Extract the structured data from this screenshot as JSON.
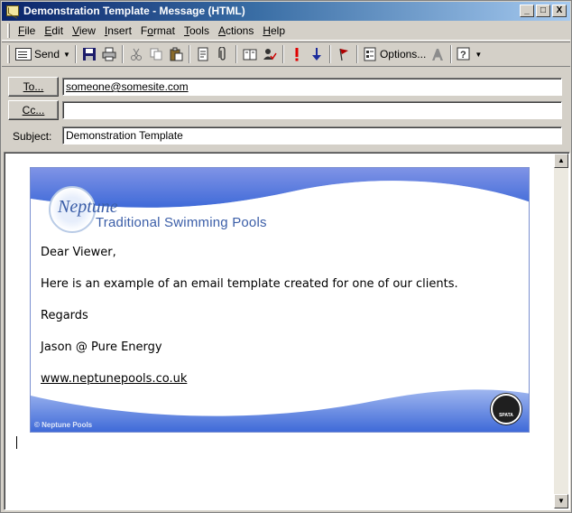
{
  "window": {
    "title": "Demonstration Template - Message (HTML)",
    "controls": {
      "minimize": "_",
      "maximize": "□",
      "close": "X"
    }
  },
  "menubar": {
    "items": [
      {
        "label": "File",
        "underline": "F",
        "rest": "ile"
      },
      {
        "label": "Edit",
        "underline": "E",
        "rest": "dit"
      },
      {
        "label": "View",
        "underline": "V",
        "rest": "iew"
      },
      {
        "label": "Insert",
        "underline": "I",
        "rest": "nsert"
      },
      {
        "label": "Format",
        "underline": "o",
        "prefix": "F",
        "rest": "rmat"
      },
      {
        "label": "Tools",
        "underline": "T",
        "rest": "ools"
      },
      {
        "label": "Actions",
        "underline": "A",
        "rest": "ctions"
      },
      {
        "label": "Help",
        "underline": "H",
        "rest": "elp"
      }
    ]
  },
  "toolbar": {
    "send_label": "Send",
    "options_label": "Options...",
    "icons": [
      "send-icon",
      "save-icon",
      "print-icon",
      "cut-icon",
      "copy-icon",
      "paste-icon",
      "insert-file-icon",
      "attach-icon",
      "address-book-icon",
      "check-names-icon",
      "importance-high-icon",
      "importance-low-icon",
      "flag-icon",
      "options-icon",
      "font-icon",
      "help-icon"
    ]
  },
  "header": {
    "to_button": "To...",
    "cc_button": "Cc...",
    "subject_label": "Subject:",
    "to_value": "someone@somesite.com",
    "cc_value": "",
    "subject_value": "Demonstration Template"
  },
  "email": {
    "brand_name": "Neptune",
    "brand_tagline": "Traditional Swimming Pools",
    "greeting": "Dear Viewer,",
    "body": "Here is an example of an email template created for one of our clients.",
    "closing": "Regards",
    "signature": "Jason @ Pure Energy",
    "link": "www.neptunepools.co.uk",
    "footer_note": "© Neptune Pools",
    "badge_text": "SPATA"
  },
  "colors": {
    "titlebar_start": "#0a246a",
    "titlebar_end": "#a6caf0",
    "wave_blue": "#3f6ad8",
    "wave_light": "#9fb6ef",
    "chrome": "#d4d0c8"
  }
}
